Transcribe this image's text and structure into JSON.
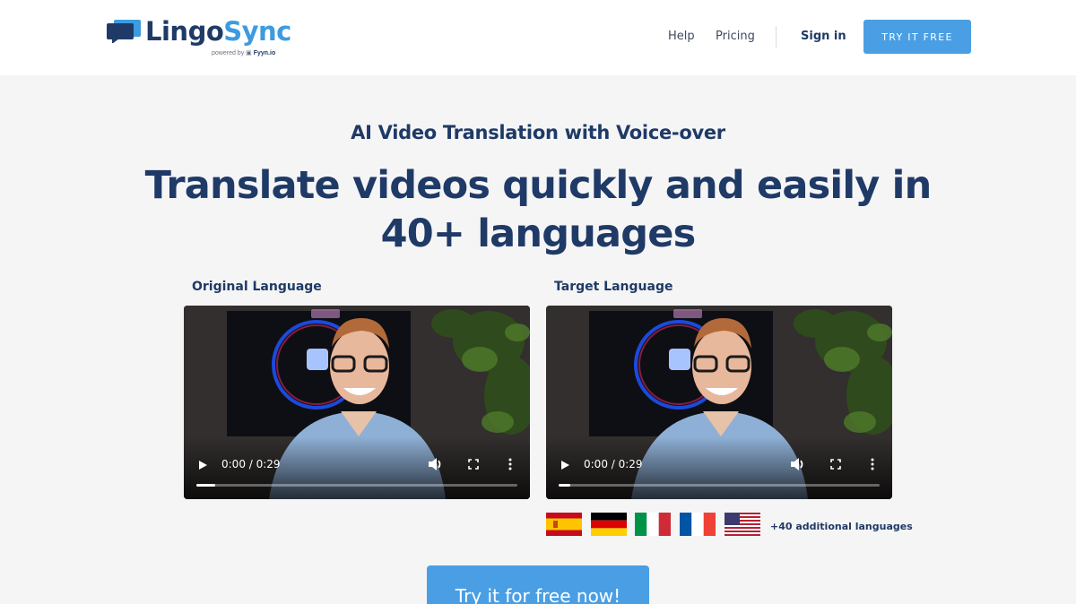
{
  "brand": {
    "name_part1": "Lingo",
    "name_part2": "Sync",
    "powered_prefix": "powered by",
    "powered_brand": "Fyyn.io",
    "logo_icon": "chat-bubbles-icon"
  },
  "nav": {
    "help": "Help",
    "pricing": "Pricing",
    "signin": "Sign in",
    "try_free": "TRY IT FREE"
  },
  "hero": {
    "subtitle": "AI Video Translation with Voice-over",
    "headline": "Translate videos quickly and easily in 40+ languages"
  },
  "videos": {
    "original": {
      "label": "Original Language",
      "time": "0:00 / 0:29",
      "progress": 0.06
    },
    "target": {
      "label": "Target Language",
      "time": "0:00 / 0:29",
      "progress": 0.035
    }
  },
  "languages": {
    "flags": [
      "spain-flag-icon",
      "germany-flag-icon",
      "italy-flag-icon",
      "france-flag-icon",
      "usa-flag-icon"
    ],
    "more": "+40 additional languages"
  },
  "cta": {
    "label": "Try it for free now!"
  },
  "colors": {
    "accent": "#4a9fe4",
    "navy": "#1f3a66",
    "background": "#f5f5f6"
  }
}
